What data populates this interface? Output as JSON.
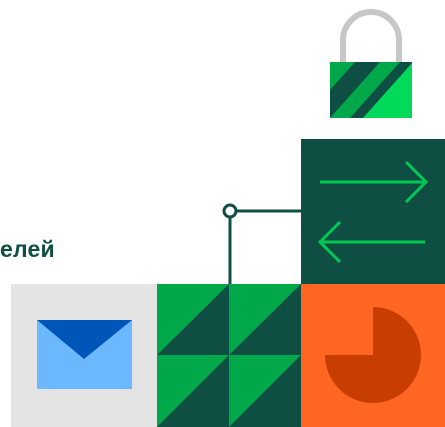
{
  "text": {
    "partial_heading": "елей"
  },
  "icons": {
    "lock": "lock-icon",
    "transfer": "arrows-exchange-icon",
    "envelope": "envelope-icon",
    "pie": "pie-chart-icon",
    "triangles": "triangle-pattern-tile"
  },
  "colors": {
    "dark_green": "#0f4f43",
    "bright_green": "#00a84a",
    "light_green": "#00d95a",
    "orange": "#ff6622",
    "dark_orange": "#c83e00",
    "light_blue": "#6cb8ff",
    "dark_blue": "#0055b8",
    "light_gray": "#e4e4e4",
    "lock_shackle": "#c7c7c7"
  }
}
